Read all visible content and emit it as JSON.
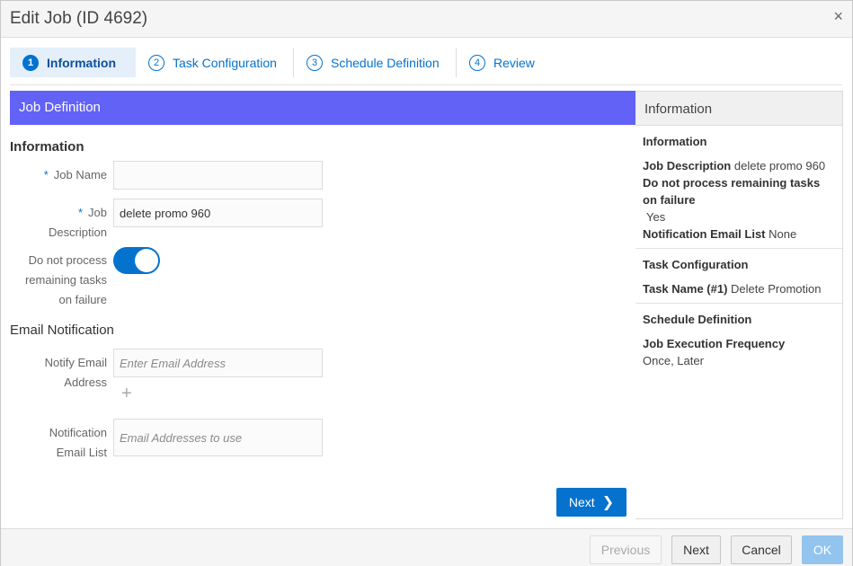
{
  "dialog": {
    "title": "Edit Job (ID 4692)",
    "close_glyph": "×"
  },
  "train": {
    "steps": [
      {
        "num": "1",
        "label": "Information"
      },
      {
        "num": "2",
        "label": "Task Configuration"
      },
      {
        "num": "3",
        "label": "Schedule Definition"
      },
      {
        "num": "4",
        "label": "Review"
      }
    ]
  },
  "main": {
    "header": "Job Definition",
    "info_heading": "Information",
    "job_name": {
      "required": "*",
      "label": "Job Name",
      "value": ""
    },
    "job_description": {
      "required": "*",
      "label_line1": "Job",
      "label_line2": "Description",
      "value": "delete promo 960"
    },
    "no_process": {
      "line1": "Do not process",
      "line2": "remaining tasks",
      "line3": "on failure",
      "on": true
    },
    "email_heading": "Email Notification",
    "notify_email": {
      "line1": "Notify Email",
      "line2": "Address",
      "placeholder": "Enter Email Address"
    },
    "add_glyph": "+",
    "notification_list": {
      "line1": "Notification",
      "line2": "Email List",
      "placeholder": "Email Addresses to use"
    },
    "next_label": "Next",
    "next_glyph": "❯"
  },
  "side": {
    "heading": "Information",
    "info": {
      "title": "Information",
      "job_desc_label": "Job Description",
      "job_desc_value": "delete promo 960",
      "no_process_label": "Do not process remaining tasks on failure",
      "no_process_value": "Yes",
      "email_list_label": "Notification Email List",
      "email_list_value": "None"
    },
    "task": {
      "title": "Task Configuration",
      "label": "Task Name (#1)",
      "value": "Delete Promotion"
    },
    "schedule": {
      "title": "Schedule Definition",
      "label": "Job Execution Frequency",
      "value": "Once, Later"
    }
  },
  "footer": {
    "previous": "Previous",
    "next": "Next",
    "cancel": "Cancel",
    "ok": "OK"
  },
  "colors": {
    "accent": "#0572ce",
    "header_bar": "#6262f7"
  }
}
